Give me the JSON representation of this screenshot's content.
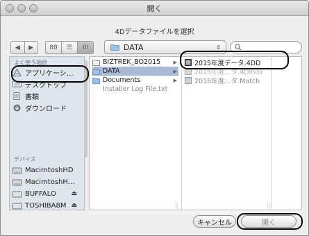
{
  "window": {
    "title": "開く",
    "subtitle": "4Dデータファイルを選択"
  },
  "toolbar": {
    "back_icon": "◀",
    "forward_icon": "▶",
    "view_icon_view": "88",
    "view_list_view": "☰",
    "view_column_view": "III",
    "path_label": "DATA",
    "search_placeholder": ""
  },
  "sidebar": {
    "favorites_heading": "よく使う項目",
    "favorites": [
      {
        "label": "アプリケーシ…",
        "icon": "applications-icon"
      },
      {
        "label": "デスクトップ",
        "icon": "desktop-icon"
      },
      {
        "label": "書類",
        "icon": "documents-icon"
      },
      {
        "label": "ダウンロード",
        "icon": "downloads-icon"
      }
    ],
    "devices_heading": "デバイス",
    "devices": [
      {
        "label": "MacimtoshHD",
        "eject": false
      },
      {
        "label": "MacimtoshH…",
        "eject": false
      },
      {
        "label": "BUFFALO",
        "eject": true
      },
      {
        "label": "TOSHIBA8M",
        "eject": true
      }
    ]
  },
  "columns": {
    "col1": [
      {
        "label": "BIZTREK_BO2015",
        "type": "folder",
        "arrow": true,
        "selected": false
      },
      {
        "label": "DATA",
        "type": "folder",
        "arrow": true,
        "selected": true
      },
      {
        "label": "Documents",
        "type": "folder",
        "arrow": true,
        "selected": false
      },
      {
        "label": "Installer Log File.txt",
        "type": "file",
        "arrow": false,
        "selected": false
      }
    ],
    "col2": [
      {
        "label": "2015年度データ.4DD",
        "type": "4dd",
        "dimmed": false
      },
      {
        "label": "2015年度…タ.4DIndx",
        "type": "index",
        "dimmed": true
      },
      {
        "label": "2015年度…タ.Match",
        "type": "match",
        "dimmed": true
      }
    ]
  },
  "buttons": {
    "cancel_label": "キャンセル",
    "open_label": "開く"
  }
}
